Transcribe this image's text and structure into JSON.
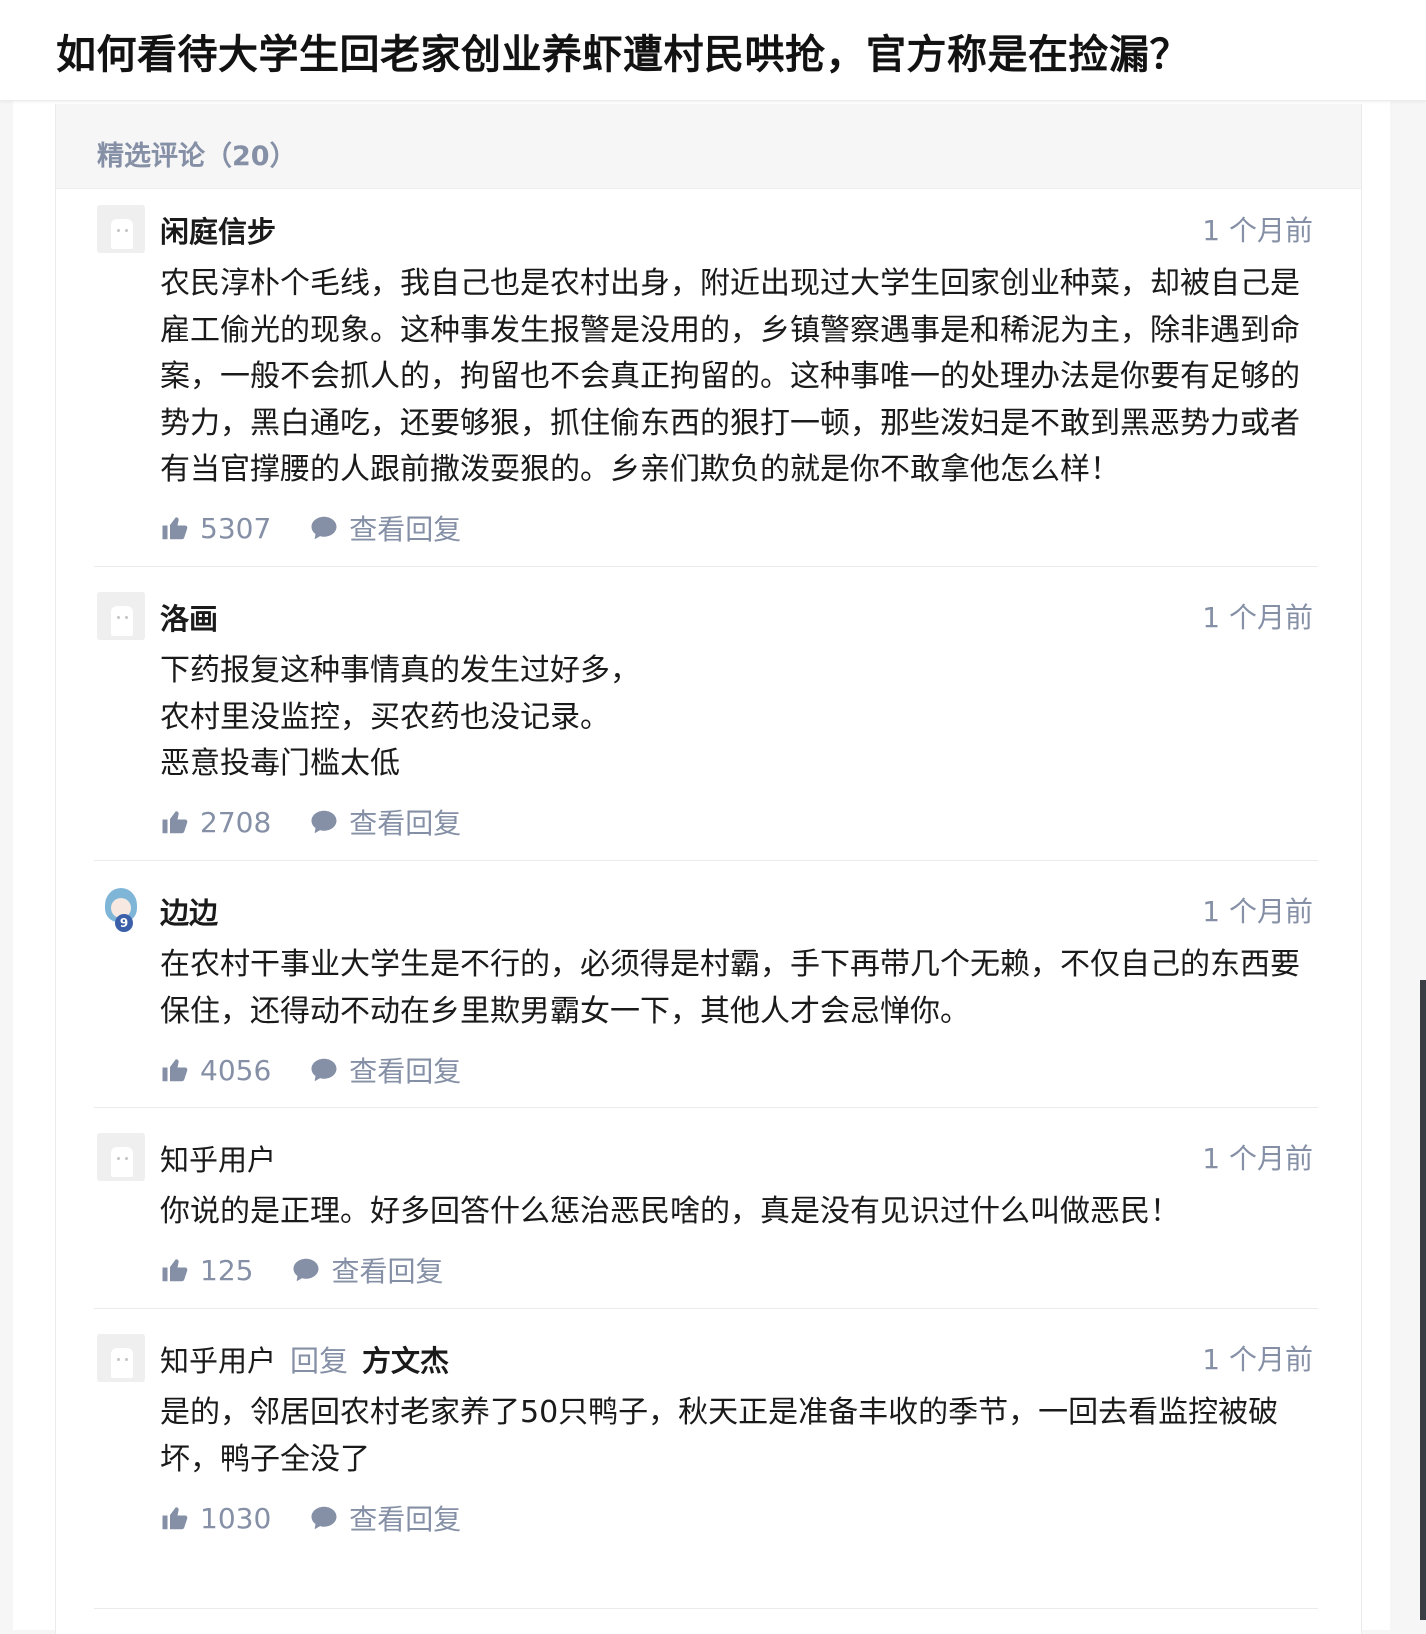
{
  "page": {
    "title": "如何看待大学生回老家创业养虾遭村民哄抢，官方称是在捡漏？"
  },
  "section": {
    "title": "精选评论（20）"
  },
  "comments": [
    {
      "author": "闲庭信步",
      "time": "1 个月前",
      "body": "农民淳朴个毛线，我自己也是农村出身，附近出现过大学生回家创业种菜，却被自己是雇工偷光的现象。这种事发生报警是没用的，乡镇警察遇事是和稀泥为主，除非遇到命案，一般不会抓人的，拘留也不会真正拘留的。这种事唯一的处理办法是你要有足够的势力，黑白通吃，还要够狠，抓住偷东西的狠打一顿，那些泼妇是不敢到黑恶势力或者有当官撑腰的人跟前撒泼耍狠的。乡亲们欺负的就是你不敢拿他怎么样！",
      "likes": "5307",
      "reply_label": "查看回复"
    },
    {
      "author": "洛画",
      "time": "1 个月前",
      "body": "下药报复这种事情真的发生过好多，\n农村里没监控，买农药也没记录。\n恶意投毒门槛太低",
      "likes": "2708",
      "reply_label": "查看回复"
    },
    {
      "author": "边边",
      "time": "1 个月前",
      "body": "在农村干事业大学生是不行的，必须得是村霸，手下再带几个无赖，不仅自己的东西要保住，还得动不动在乡里欺男霸女一下，其他人才会忌惮你。",
      "likes": "4056",
      "reply_label": "查看回复",
      "avatar_badge": "9"
    },
    {
      "author": "知乎用户",
      "time": "1 个月前",
      "body": "你说的是正理。好多回答什么惩治恶民啥的，真是没有见识过什么叫做恶民！",
      "likes": "125",
      "reply_label": "查看回复"
    },
    {
      "author": "知乎用户",
      "reply_word": "回复",
      "reply_to": "方文杰",
      "time": "1 个月前",
      "body": "是的，邻居回农村老家养了50只鸭子，秋天正是准备丰收的季节，一回去看监控被破坏，鸭子全没了",
      "likes": "1030",
      "reply_label": "查看回复"
    }
  ],
  "colors": {
    "meta": "#8590a6",
    "text": "#1a1a1a",
    "header_bg": "#f6f6f6"
  },
  "icons": {
    "like": "thumbs-up-icon",
    "reply": "speech-bubble-icon"
  }
}
